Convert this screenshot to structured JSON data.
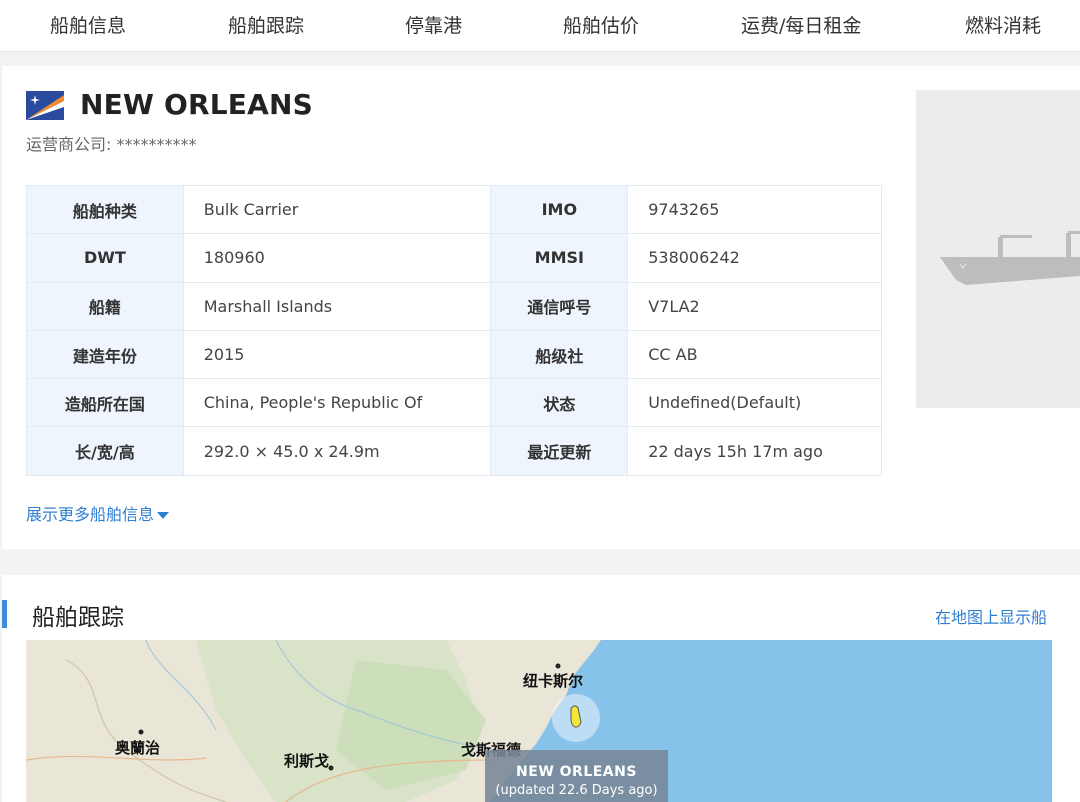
{
  "nav": {
    "tabs": [
      "船舶信息",
      "船舶跟踪",
      "停靠港",
      "船舶估价",
      "运费/每日租金",
      "燃料消耗"
    ]
  },
  "ship": {
    "name": "NEW ORLEANS",
    "operator": "运营商公司: **********",
    "flag_icon": "marshall-islands-flag-icon"
  },
  "info_table": {
    "rows": [
      {
        "k1": "船舶种类",
        "v1": "Bulk Carrier",
        "k2": "IMO",
        "v2": "9743265"
      },
      {
        "k1": "DWT",
        "v1": "180960",
        "k2": "MMSI",
        "v2": "538006242"
      },
      {
        "k1": "船籍",
        "v1": "Marshall Islands",
        "k2": "通信呼号",
        "v2": "V7LA2"
      },
      {
        "k1": "建造年份",
        "v1": "2015",
        "k2": "船级社",
        "v2": "CC AB"
      },
      {
        "k1": "造船所在国",
        "v1": "China, People's Republic Of",
        "k2": "状态",
        "v2": "Undefined(Default)"
      },
      {
        "k1": "长/宽/高",
        "v1": "292.0 × 45.0 x 24.9m",
        "k2": "最近更新",
        "v2": "22 days 15h 17m ago"
      }
    ]
  },
  "more_link": "展示更多船舶信息",
  "tracking": {
    "title": "船舶跟踪",
    "map_link": "在地图上显示船",
    "cities": {
      "newcastle": "纽卡斯尔",
      "orange": "奥蘭治",
      "lithgow": "利斯戈",
      "gosford": "戈斯福德"
    },
    "tooltip": {
      "name": "NEW ORLEANS",
      "updated": "(updated 22.6 Days ago)"
    }
  },
  "colors": {
    "accent": "#3d8ddb",
    "link": "#2f7fd1",
    "table_key_bg": "#eef5fc",
    "sea": "#86c2e9",
    "land": "#e8e4d6",
    "ship_marker": "#f2e63a"
  }
}
